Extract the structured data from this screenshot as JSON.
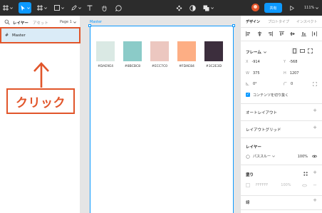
{
  "toolbar": {
    "share_label": "共有",
    "zoom_label": "111%"
  },
  "left_panel": {
    "tab_layers": "レイヤー",
    "tab_assets": "アセット",
    "page_label": "Page 1",
    "layer_name": "Master"
  },
  "annotation": {
    "label": "クリック",
    "color": "#e1552a"
  },
  "canvas": {
    "frame_title": "Master",
    "swatches": [
      {
        "hex": "#DAE9E4",
        "label": "#DAE9E4"
      },
      {
        "hex": "#8BCBC8",
        "label": "#8BCBC8"
      },
      {
        "hex": "#ECC7C0",
        "label": "#ECC7C0"
      },
      {
        "hex": "#FDAE84",
        "label": "#FDAE84"
      },
      {
        "hex": "#3C2E3D",
        "label": "#3C2E3D"
      }
    ]
  },
  "right_panel": {
    "tab_design": "デザイン",
    "tab_prototype": "プロトタイプ",
    "tab_inspect": "インスペクト",
    "frame_section": "フレーム",
    "x_label": "X",
    "x_value": "-914",
    "y_label": "Y",
    "y_value": "-568",
    "w_label": "W",
    "w_value": "375",
    "h_label": "H",
    "h_value": "1207",
    "rotation_value": "0°",
    "radius_value": "0",
    "clip_content_label": "コンテンツを切り抜く",
    "auto_layout_label": "オートレイアウト",
    "layout_grid_label": "レイアウトグリッド",
    "layer_section": "レイヤー",
    "blend_mode": "パススルー",
    "layer_opacity": "100%",
    "fill_section": "塗り",
    "fill_hex": "FFFFFF",
    "fill_opacity": "100%",
    "stroke_section": "線"
  },
  "colors": {
    "accent": "#0d99ff",
    "toolbar_bg": "#2c2c2c",
    "canvas_bg": "#e5e5e5",
    "selection_bg": "#daebf7"
  }
}
